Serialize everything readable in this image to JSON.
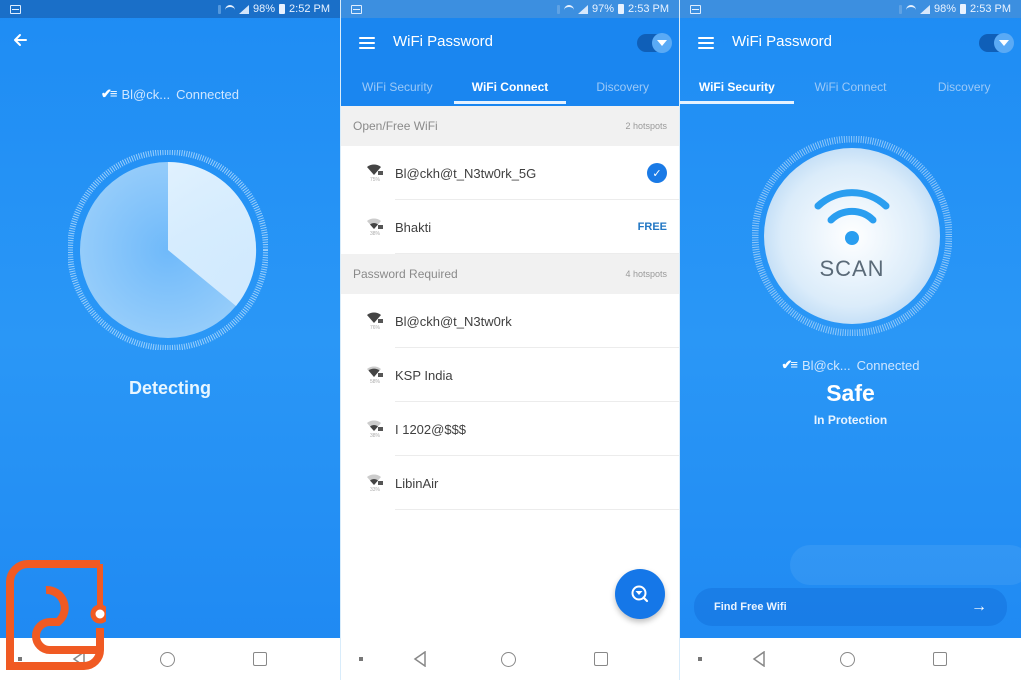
{
  "screens": [
    {
      "status": {
        "battery": "98%",
        "time": "2:52 PM"
      },
      "back_icon": "arrow-left-icon",
      "connection": {
        "network": "Bl@ck...",
        "status": "Connected"
      },
      "detect_label": "Detecting",
      "scan_progress_degrees_label": "sweep"
    },
    {
      "status": {
        "battery": "97%",
        "time": "2:53 PM"
      },
      "app_title": "WiFi Password",
      "tabs": [
        {
          "label": "WiFi Security",
          "active": false
        },
        {
          "label": "WiFi Connect",
          "active": true
        },
        {
          "label": "Discovery",
          "active": false
        }
      ],
      "sections": [
        {
          "title": "Open/Free WiFi",
          "count": "2 hotspots",
          "networks": [
            {
              "ssid": "Bl@ckh@t_N3tw0rk_5G",
              "signal": "75%",
              "badge": "connected"
            },
            {
              "ssid": "Bhakti",
              "signal": "38%",
              "badge": "FREE"
            }
          ]
        },
        {
          "title": "Password Required",
          "count": "4 hotspots",
          "networks": [
            {
              "ssid": "Bl@ckh@t_N3tw0rk",
              "signal": "76%"
            },
            {
              "ssid": "KSP India",
              "signal": "58%"
            },
            {
              "ssid": "I 1202@$$$",
              "signal": "38%"
            },
            {
              "ssid": "LibinAir",
              "signal": "33%"
            }
          ]
        }
      ],
      "fab_icon": "search-wifi-icon"
    },
    {
      "status": {
        "battery": "98%",
        "time": "2:53 PM"
      },
      "app_title": "WiFi Password",
      "tabs": [
        {
          "label": "WiFi Security",
          "active": true
        },
        {
          "label": "WiFi Connect",
          "active": false
        },
        {
          "label": "Discovery",
          "active": false
        }
      ],
      "scan_label": "SCAN",
      "connection": {
        "network": "Bl@ck...",
        "status": "Connected"
      },
      "safety_status": "Safe",
      "protection_label": "In Protection",
      "find_free_label": "Find Free Wifi"
    }
  ],
  "colors": {
    "primary_blue": "#1a86f0",
    "status_bar": "#1a6fc8",
    "fab_blue": "#1577e8",
    "free_badge": "#2277c4",
    "watermark_orange": "#f05a23"
  }
}
